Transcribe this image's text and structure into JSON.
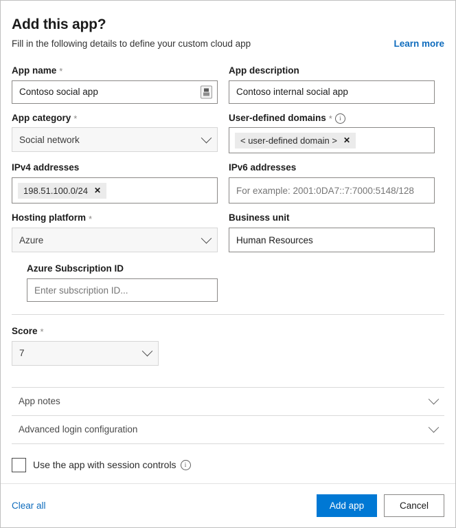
{
  "dialog": {
    "title": "Add this app?",
    "subtitle": "Fill in the following details to define your custom cloud app",
    "learn_more_label": "Learn more"
  },
  "fields": {
    "app_name": {
      "label": "App name",
      "required_marker": "*",
      "value": "Contoso social app",
      "trailing_icon": "form-fill-icon"
    },
    "app_description": {
      "label": "App description",
      "value": "Contoso internal social app"
    },
    "app_category": {
      "label": "App category",
      "required_marker": "*",
      "selected": "Social network"
    },
    "user_defined_domains": {
      "label": "User-defined domains",
      "required_marker": "*",
      "info_icon": "info-icon",
      "chips": [
        "< user-defined domain >"
      ]
    },
    "ipv4_addresses": {
      "label": "IPv4 addresses",
      "chips": [
        "198.51.100.0/24"
      ]
    },
    "ipv6_addresses": {
      "label": "IPv6 addresses",
      "placeholder": "For example: 2001:0DA7::7:7000:5148/128",
      "value": ""
    },
    "hosting_platform": {
      "label": "Hosting platform",
      "required_marker": "*",
      "selected": "Azure"
    },
    "business_unit": {
      "label": "Business unit",
      "value": "Human Resources"
    },
    "azure_subscription_id": {
      "label": "Azure Subscription ID",
      "placeholder": "Enter subscription ID...",
      "value": ""
    },
    "score": {
      "label": "Score",
      "required_marker": "*",
      "selected": "7"
    }
  },
  "accordions": [
    {
      "label": "App notes"
    },
    {
      "label": "Advanced login configuration"
    }
  ],
  "session_controls": {
    "label": "Use the app with session controls",
    "checked": false,
    "info_icon": "info-icon"
  },
  "footer": {
    "clear_all_label": "Clear all",
    "primary_label": "Add app",
    "secondary_label": "Cancel"
  },
  "colors": {
    "accent": "#0078d4",
    "link": "#0f6cbd",
    "border": "#8a8886",
    "divider": "#d9d9d9"
  },
  "chip_remove_glyph": "✕"
}
